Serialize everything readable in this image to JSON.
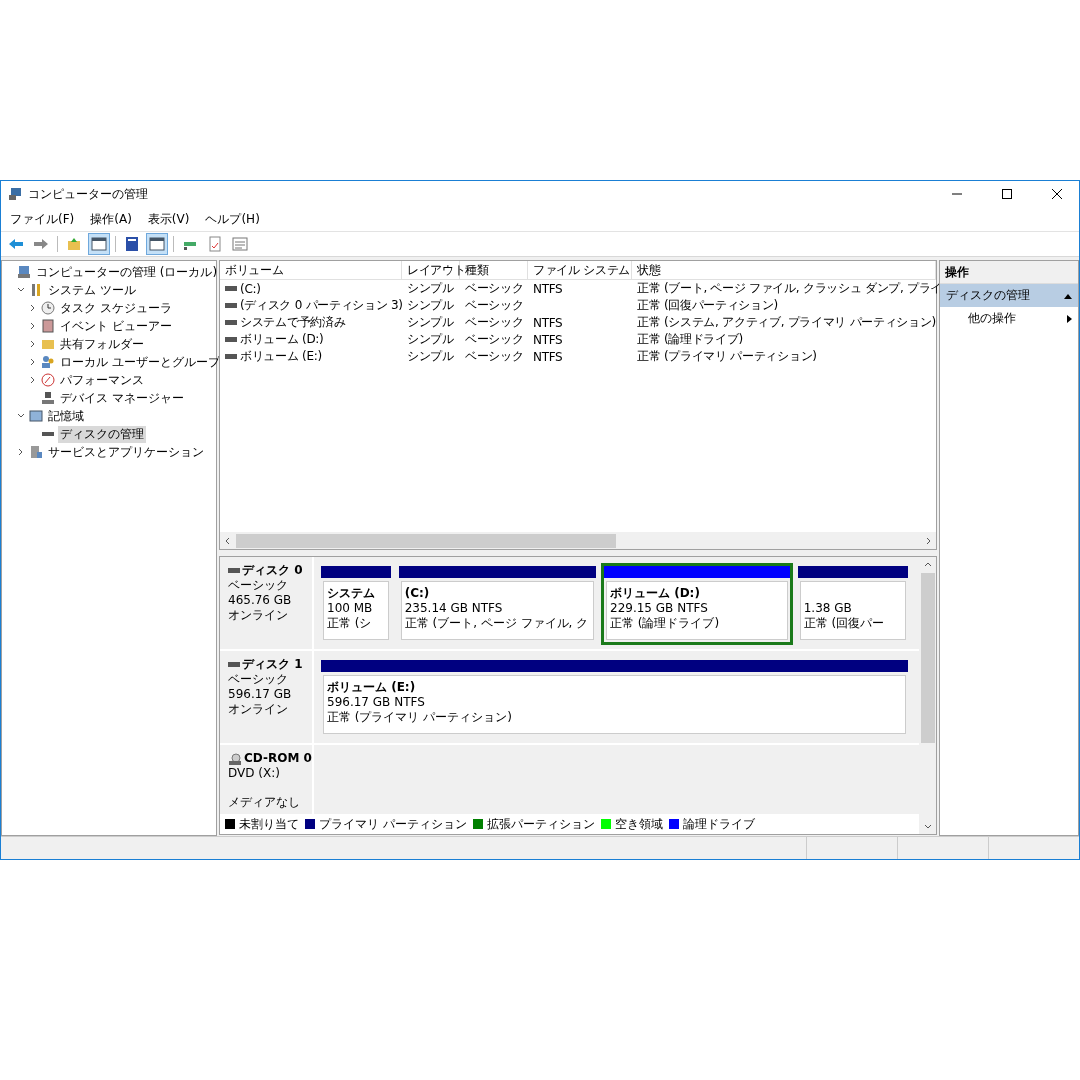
{
  "window": {
    "title": "コンピューターの管理"
  },
  "menu": [
    "ファイル(F)",
    "操作(A)",
    "表示(V)",
    "ヘルプ(H)"
  ],
  "toolbar": [
    {
      "kind": "back",
      "selected": false
    },
    {
      "kind": "forward",
      "selected": false
    },
    {
      "kind": "sep"
    },
    {
      "kind": "up",
      "selected": false
    },
    {
      "kind": "console",
      "selected": true
    },
    {
      "kind": "sep"
    },
    {
      "kind": "help",
      "selected": false
    },
    {
      "kind": "pane",
      "selected": true
    },
    {
      "kind": "sep"
    },
    {
      "kind": "connect",
      "selected": false
    },
    {
      "kind": "check",
      "selected": false
    },
    {
      "kind": "list",
      "selected": false
    }
  ],
  "tree": [
    {
      "label": "コンピューターの管理 (ローカル)",
      "kind": "computer",
      "selected": false,
      "children": [
        {
          "label": "システム ツール",
          "kind": "tools",
          "expanded": true,
          "selected": false,
          "children": [
            {
              "label": "タスク スケジューラ",
              "kind": "clock",
              "expanded": false,
              "selected": false
            },
            {
              "label": "イベント ビューアー",
              "kind": "log",
              "expanded": false,
              "selected": false
            },
            {
              "label": "共有フォルダー",
              "kind": "folder",
              "expanded": false,
              "selected": false
            },
            {
              "label": "ローカル ユーザーとグループ",
              "kind": "users",
              "expanded": false,
              "selected": false
            },
            {
              "label": "パフォーマンス",
              "kind": "gauge",
              "expanded": false,
              "selected": false
            },
            {
              "label": "デバイス マネージャー",
              "kind": "device",
              "selected": false
            }
          ]
        },
        {
          "label": "記憶域",
          "kind": "storage",
          "expanded": true,
          "selected": false,
          "children": [
            {
              "label": "ディスクの管理",
              "kind": "disk",
              "selected": true
            }
          ]
        },
        {
          "label": "サービスとアプリケーション",
          "kind": "services",
          "expanded": false,
          "selected": false
        }
      ]
    }
  ],
  "volumes": {
    "columns": [
      "ボリューム",
      "レイアウト",
      "種類",
      "ファイル システム",
      "状態"
    ],
    "rows": [
      [
        "(C:)",
        "シンプル",
        "ベーシック",
        "NTFS",
        "正常 (ブート, ページ ファイル, クラッシュ ダンプ, プライ"
      ],
      [
        "(ディスク 0 パーティション 3)",
        "シンプル",
        "ベーシック",
        "",
        "正常 (回復パーティション)"
      ],
      [
        "システムで予約済み",
        "シンプル",
        "ベーシック",
        "NTFS",
        "正常 (システム, アクティブ, プライマリ パーティション)"
      ],
      [
        "ボリューム (D:)",
        "シンプル",
        "ベーシック",
        "NTFS",
        "正常 (論理ドライブ)"
      ],
      [
        "ボリューム (E:)",
        "シンプル",
        "ベーシック",
        "NTFS",
        "正常 (プライマリ パーティション)"
      ]
    ]
  },
  "disks": [
    {
      "kind": "disk",
      "name": "ディスク 0",
      "type": "ベーシック",
      "size": "465.76 GB",
      "status": "オンライン",
      "partitions": [
        {
          "kind": "primary",
          "title": "システム",
          "size": "100 MB",
          "status": "正常 (シ",
          "selected": false
        },
        {
          "kind": "primary",
          "title": "(C:)",
          "size": "235.14 GB NTFS",
          "status": "正常 (ブート, ページ ファイル, ク",
          "selected": false
        },
        {
          "kind": "logical",
          "title": "ボリューム  (D:)",
          "size": "229.15 GB NTFS",
          "status": "正常 (論理ドライブ)",
          "selected": true
        },
        {
          "kind": "primary",
          "size": "1.38 GB",
          "status": "正常 (回復パー",
          "selected": false
        }
      ]
    },
    {
      "kind": "disk",
      "name": "ディスク 1",
      "type": "ベーシック",
      "size": "596.17 GB",
      "status": "オンライン",
      "partitions": [
        {
          "kind": "primary",
          "title": "ボリューム  (E:)",
          "size": "596.17 GB NTFS",
          "status": "正常 (プライマリ パーティション)",
          "selected": false
        }
      ]
    },
    {
      "kind": "cdrom",
      "name": "CD-ROM 0",
      "type": "DVD (X:)",
      "status": "メディアなし"
    }
  ],
  "legend": [
    {
      "label": "未割り当て",
      "color": "#000000"
    },
    {
      "label": "プライマリ パーティション",
      "color": "#000080"
    },
    {
      "label": "拡張パーティション",
      "color": "#008000"
    },
    {
      "label": "空き領域",
      "color": "#00ff00"
    },
    {
      "label": "論理ドライブ",
      "color": "#0000ff"
    }
  ],
  "actions": {
    "title": "操作",
    "sections": [
      {
        "label": "ディスクの管理",
        "expanded": true,
        "items": [
          "他の操作"
        ]
      }
    ]
  }
}
